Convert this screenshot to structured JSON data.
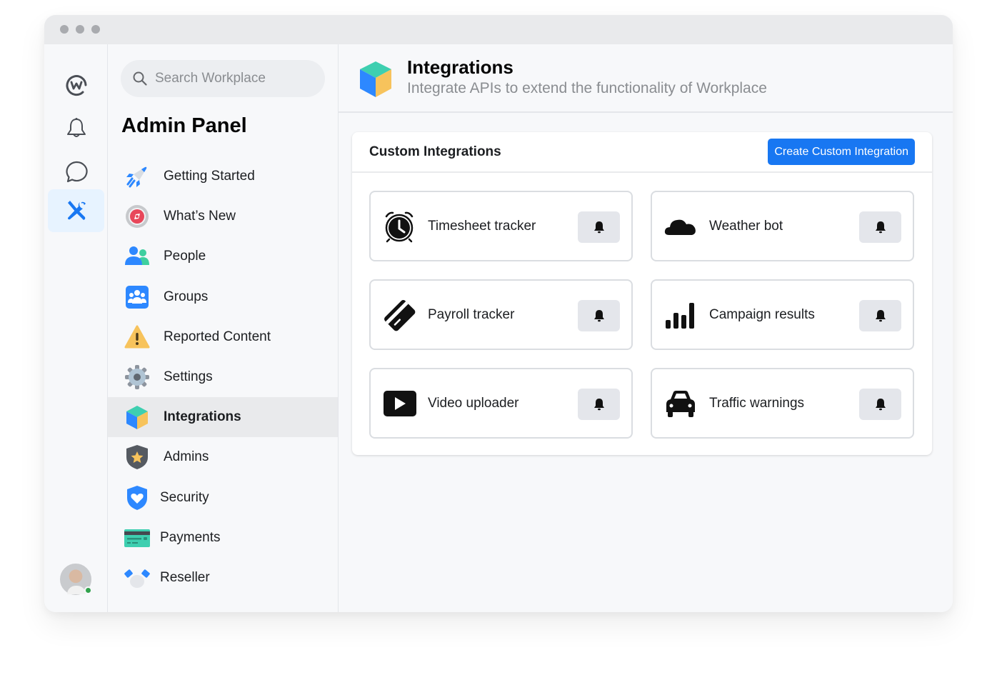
{
  "window": {
    "traffic_lights": [
      "close",
      "minimize",
      "maximize"
    ]
  },
  "rail": {
    "items": [
      {
        "name": "workplace-logo",
        "icon": "workplace-icon",
        "active": false
      },
      {
        "name": "notifications",
        "icon": "bell-icon",
        "active": false
      },
      {
        "name": "chat",
        "icon": "chat-bubble-icon",
        "active": false
      },
      {
        "name": "admin-tools",
        "icon": "tools-icon",
        "active": true
      }
    ],
    "user": {
      "icon": "avatar",
      "status": "online",
      "status_color": "#31a24c"
    }
  },
  "nav": {
    "search": {
      "placeholder": "Search Workplace",
      "value": ""
    },
    "title": "Admin Panel",
    "items": [
      {
        "label": "Getting Started",
        "icon": "rocket-icon",
        "active": false
      },
      {
        "label": "What’s New",
        "icon": "compass-icon",
        "active": false
      },
      {
        "label": "People",
        "icon": "people-icon",
        "active": false
      },
      {
        "label": "Groups",
        "icon": "groups-icon",
        "active": false
      },
      {
        "label": "Reported Content",
        "icon": "warning-icon",
        "active": false
      },
      {
        "label": "Settings",
        "icon": "gear-icon",
        "active": false
      },
      {
        "label": "Integrations",
        "icon": "cube-icon",
        "active": true
      },
      {
        "label": "Admins",
        "icon": "admin-shield-star-icon",
        "active": false
      },
      {
        "label": "Security",
        "icon": "shield-heart-icon",
        "active": false
      },
      {
        "label": "Payments",
        "icon": "credit-card-icon",
        "active": false
      },
      {
        "label": "Reseller",
        "icon": "handshake-icon",
        "active": false
      }
    ]
  },
  "header": {
    "title": "Integrations",
    "subtitle": "Integrate APIs to extend the functionality of Workplace"
  },
  "custom_integrations": {
    "title": "Custom Integrations",
    "create_button": "Create Custom Integration",
    "accent": "#1877f2",
    "items": [
      {
        "label": "Timesheet tracker",
        "icon": "alarm-clock-icon"
      },
      {
        "label": "Weather bot",
        "icon": "cloud-icon"
      },
      {
        "label": "Payroll tracker",
        "icon": "credit-card-icon"
      },
      {
        "label": "Campaign results",
        "icon": "bar-chart-icon"
      },
      {
        "label": "Video uploader",
        "icon": "play-icon"
      },
      {
        "label": "Traffic warnings",
        "icon": "car-icon"
      }
    ]
  }
}
